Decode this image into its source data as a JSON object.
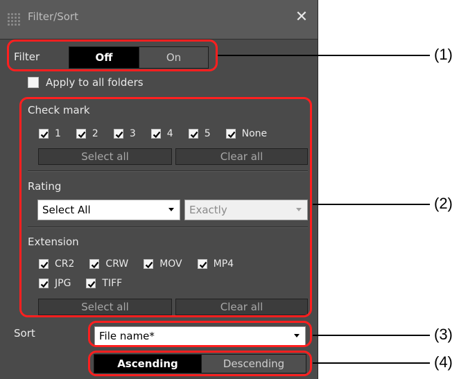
{
  "titlebar": {
    "title": "Filter/Sort",
    "close": "✕"
  },
  "filter": {
    "label": "Filter",
    "off": "Off",
    "on": "On"
  },
  "apply_all": "Apply to all folders",
  "check_mark": {
    "label": "Check mark",
    "items": [
      "1",
      "2",
      "3",
      "4",
      "5",
      "None"
    ],
    "select_all": "Select all",
    "clear_all": "Clear all"
  },
  "rating": {
    "label": "Rating",
    "select_value": "Select All",
    "match_value": "Exactly"
  },
  "extension": {
    "label": "Extension",
    "items": [
      "CR2",
      "CRW",
      "MOV",
      "MP4",
      "JPG",
      "TIFF"
    ],
    "select_all": "Select all",
    "clear_all": "Clear all"
  },
  "sort": {
    "label": "Sort",
    "value": "File name*",
    "ascending": "Ascending",
    "descending": "Descending"
  },
  "callouts": [
    "(1)",
    "(2)",
    "(3)",
    "(4)"
  ],
  "colors": {
    "highlight": "#ff1f1f",
    "panel": "#4a4a4a"
  }
}
